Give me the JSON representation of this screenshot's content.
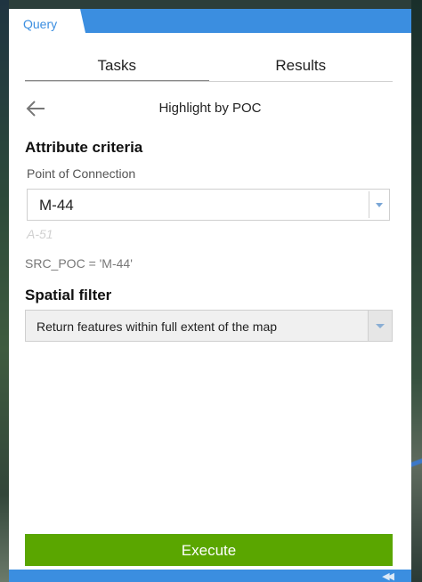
{
  "widget": {
    "title": "Query"
  },
  "tabs": [
    {
      "label": "Tasks",
      "active": true
    },
    {
      "label": "Results",
      "active": false
    }
  ],
  "task": {
    "back_icon": "back-arrow-icon",
    "title": "Highlight by POC"
  },
  "attribute_criteria": {
    "heading": "Attribute criteria",
    "field_label": "Point of Connection",
    "value": "M-44",
    "hint": "A-51",
    "expression": "SRC_POC = 'M-44'"
  },
  "spatial_filter": {
    "heading": "Spatial filter",
    "selected": "Return features within full extent of the map"
  },
  "actions": {
    "execute_label": "Execute"
  },
  "colors": {
    "accent": "#3b8ee0",
    "execute": "#5aa600"
  }
}
